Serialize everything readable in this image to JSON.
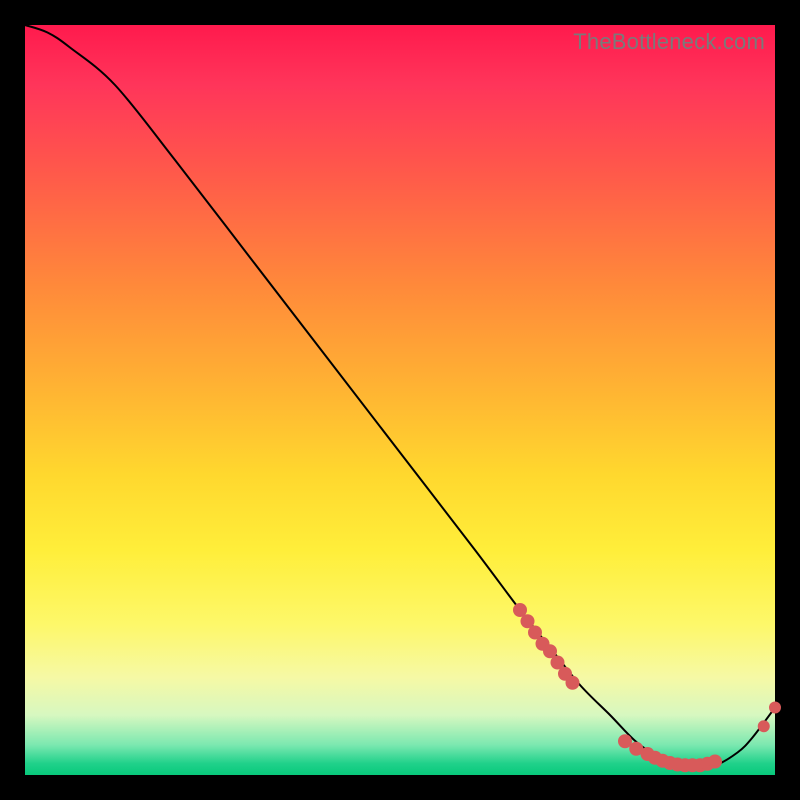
{
  "watermark": "TheBottleneck.com",
  "colors": {
    "marker": "#d85a5a",
    "curve": "#000000",
    "background": "#000000"
  },
  "chart_data": {
    "type": "line",
    "title": "",
    "xlabel": "",
    "ylabel": "",
    "xlim": [
      0,
      100
    ],
    "ylim": [
      0,
      100
    ],
    "note": "Axes are unlabeled in the source image; x/y values are normalized 0–100 estimates from pixel positions.",
    "series": [
      {
        "name": "curve",
        "kind": "line",
        "x": [
          0,
          3,
          6,
          12,
          20,
          30,
          40,
          50,
          60,
          66,
          70,
          74,
          78,
          82,
          86,
          89,
          92,
          95,
          97,
          100
        ],
        "y": [
          100,
          99,
          97,
          92,
          82,
          69,
          56,
          43,
          30,
          22,
          17,
          12,
          8,
          4,
          2,
          1.3,
          1.3,
          3,
          5,
          9
        ]
      },
      {
        "name": "cluster-upper",
        "kind": "scatter",
        "x": [
          66,
          67,
          68,
          69,
          70,
          71,
          72,
          73
        ],
        "y": [
          22,
          20.5,
          19,
          17.5,
          16.5,
          15,
          13.5,
          12.3
        ]
      },
      {
        "name": "cluster-lower",
        "kind": "scatter",
        "x": [
          80,
          81.5,
          83,
          84,
          85,
          86,
          87,
          88,
          89,
          90,
          91,
          92
        ],
        "y": [
          4.5,
          3.5,
          2.8,
          2.3,
          1.9,
          1.6,
          1.4,
          1.3,
          1.3,
          1.3,
          1.5,
          1.8
        ]
      },
      {
        "name": "tail-points",
        "kind": "scatter",
        "x": [
          98.5,
          100
        ],
        "y": [
          6.5,
          9
        ]
      }
    ]
  }
}
